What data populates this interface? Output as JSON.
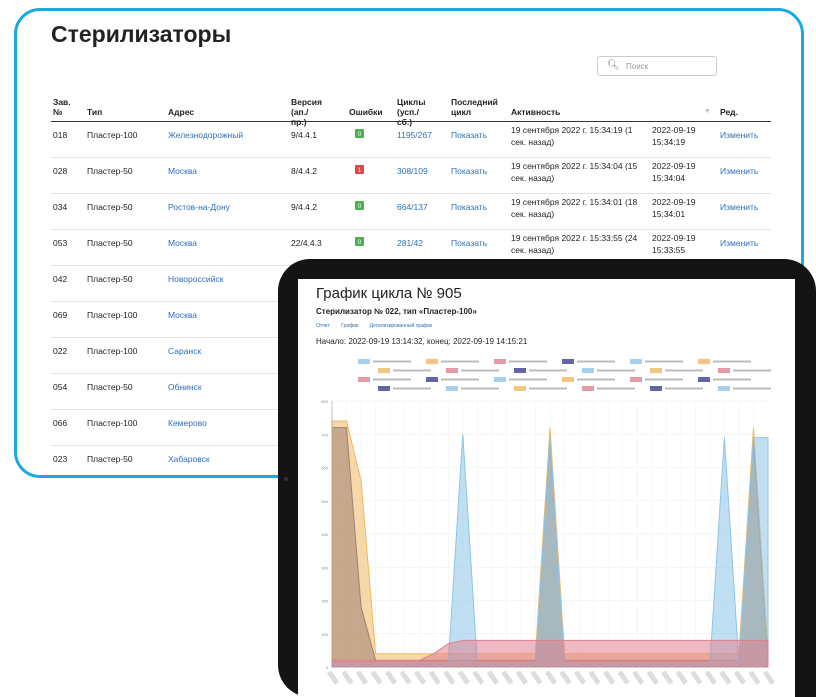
{
  "page": {
    "title": "Стерилизаторы",
    "search_placeholder": "Поиск",
    "headers": {
      "num": [
        "Зав.",
        "№"
      ],
      "type": "Тип",
      "address": "Адрес",
      "version": [
        "Версия",
        "(ап./пр.)"
      ],
      "errors": "Ошибки",
      "cycles": [
        "Циклы",
        "(усп./сб.)"
      ],
      "last": [
        "Последний",
        "цикл"
      ],
      "activity": "Активность",
      "edit": "Ред."
    },
    "rows": [
      {
        "num": "018",
        "type": "Пластер-100",
        "address": "Железнодорожный",
        "version": "9/4.4.1",
        "errors": "0",
        "error_status": "ok",
        "cycles": "1195/267",
        "show": "Показать",
        "activity": [
          "19 сентября 2022 г. 15:34:19 (1",
          "сек. назад)"
        ],
        "date": [
          "2022-09-19",
          "15:34:19"
        ],
        "edit": "Изменить"
      },
      {
        "num": "028",
        "type": "Пластер-50",
        "address": "Москва",
        "version": "8/4.4.2",
        "errors": "1",
        "error_status": "error",
        "cycles": "308/109",
        "show": "Показать",
        "activity": [
          "19 сентября 2022 г. 15:34:04 (15",
          "сек. назад)"
        ],
        "date": [
          "2022-09-19",
          "15:34:04"
        ],
        "edit": "Изменить"
      },
      {
        "num": "034",
        "type": "Пластер-50",
        "address": "Ростов-на-Дону",
        "version": "9/4.4.2",
        "errors": "0",
        "error_status": "ok",
        "cycles": "664/137",
        "show": "Показать",
        "activity": [
          "19 сентября 2022 г. 15:34:01 (18",
          "сек. назад)"
        ],
        "date": [
          "2022-09-19",
          "15:34:01"
        ],
        "edit": "Изменить"
      },
      {
        "num": "053",
        "type": "Пластер-50",
        "address": "Москва",
        "version": "22/4.4.3",
        "errors": "0",
        "error_status": "ok",
        "cycles": "281/42",
        "show": "Показать",
        "activity": [
          "19 сентября 2022 г. 15:33:55 (24",
          "сек. назад)"
        ],
        "date": [
          "2022-09-19",
          "15:33:55"
        ],
        "edit": "Изменить"
      },
      {
        "num": "042",
        "type": "Пластер-50",
        "address": "Новороссийск"
      },
      {
        "num": "069",
        "type": "Пластер-100",
        "address": "Москва"
      },
      {
        "num": "022",
        "type": "Пластер-100",
        "address": "Саранск"
      },
      {
        "num": "054",
        "type": "Пластер-50",
        "address": "Обнинск"
      },
      {
        "num": "066",
        "type": "Пластер-100",
        "address": "Кемерово"
      },
      {
        "num": "023",
        "type": "Пластер-50",
        "address": "Хабаровск"
      }
    ]
  },
  "tablet": {
    "title": "График цикла № 905",
    "subtitle": "Стерилизатор № 022, тип «Пластер-100»",
    "tabs": [
      "Отчет",
      "График",
      "Детализированный график"
    ],
    "times": "Начало: 2022-09-19 13:14:32, конец: 2022-09-19 14:15:21"
  },
  "colors": {
    "accent": "#1aa9e0",
    "link": "#2f6fb5",
    "badge_ok": "#4caf50",
    "badge_error": "#e04848",
    "series_navy": "#3f3d8f",
    "series_orange": "#f0b860",
    "series_blue": "#8cc4ea",
    "series_red": "#e08090"
  },
  "chart_data": {
    "type": "area",
    "title": "",
    "xlabel": "",
    "ylabel": "",
    "ylim": [
      0,
      800
    ],
    "yticks": [
      "0",
      "100",
      "200",
      "300",
      "400",
      "500",
      "600",
      "700",
      "800"
    ],
    "x": [
      0,
      2,
      4,
      6,
      8,
      10,
      12,
      14,
      16,
      18,
      20,
      22,
      24,
      26,
      28,
      30,
      32,
      34,
      36,
      38,
      40,
      42,
      44,
      46,
      48,
      50,
      52,
      54,
      56,
      58,
      60
    ],
    "series": [
      {
        "color": "#3f3d8f",
        "values": [
          720,
          720,
          180,
          20,
          20,
          20,
          20,
          20,
          20,
          20,
          20,
          20,
          20,
          20,
          20,
          680,
          20,
          20,
          20,
          20,
          20,
          20,
          20,
          20,
          20,
          20,
          20,
          20,
          20,
          680,
          20
        ]
      },
      {
        "color": "#f0b860",
        "values": [
          740,
          740,
          560,
          40,
          40,
          40,
          40,
          40,
          40,
          40,
          40,
          40,
          40,
          40,
          40,
          720,
          40,
          40,
          40,
          40,
          40,
          40,
          40,
          40,
          40,
          40,
          40,
          40,
          40,
          720,
          40
        ]
      },
      {
        "color": "#8cc4ea",
        "values": [
          10,
          10,
          10,
          10,
          10,
          10,
          10,
          10,
          10,
          700,
          10,
          10,
          10,
          10,
          10,
          690,
          10,
          10,
          10,
          10,
          10,
          10,
          10,
          10,
          10,
          10,
          10,
          690,
          10,
          690,
          690
        ]
      },
      {
        "color": "#e08090",
        "values": [
          20,
          20,
          20,
          20,
          20,
          20,
          20,
          40,
          70,
          80,
          80,
          80,
          80,
          80,
          80,
          80,
          80,
          80,
          80,
          80,
          80,
          80,
          80,
          80,
          80,
          80,
          80,
          80,
          80,
          80,
          80
        ]
      }
    ]
  }
}
